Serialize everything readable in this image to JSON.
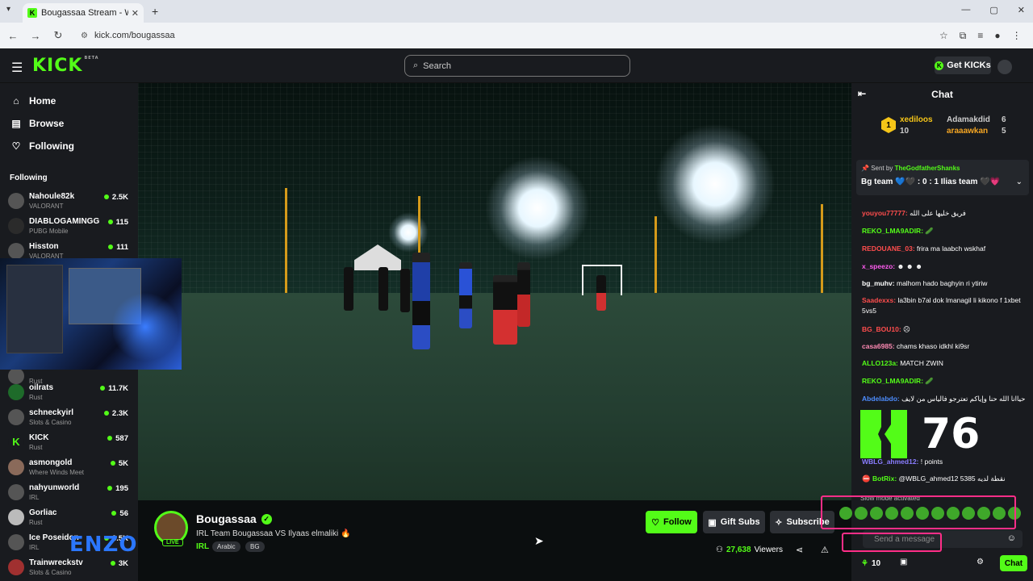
{
  "browser": {
    "tab_title": "Bougassaa Stream - Watch",
    "url": "kick.com/bougassaa"
  },
  "header": {
    "logo": "KICK",
    "logo_badge": "BETA",
    "search_placeholder": "Search",
    "get_kicks": "Get KICKs"
  },
  "sidebar": {
    "nav": [
      {
        "label": "Home",
        "icon": "home-icon"
      },
      {
        "label": "Browse",
        "icon": "browse-icon"
      },
      {
        "label": "Following",
        "icon": "heart-icon"
      }
    ],
    "following_title": "Following",
    "channels": [
      {
        "name": "Nahoule82k",
        "game": "VALORANT",
        "viewers": "2.5K"
      },
      {
        "name": "DIABLOGAMINGG",
        "game": "PUBG Mobile",
        "viewers": "115"
      },
      {
        "name": "Hisston",
        "game": "VALORANT",
        "viewers": "111"
      },
      {
        "name": "",
        "game": "Rust",
        "viewers": ""
      },
      {
        "name": "oilrats",
        "game": "Rust",
        "viewers": "11.7K"
      },
      {
        "name": "schneckyirl",
        "game": "Slots & Casino",
        "viewers": "2.3K"
      },
      {
        "name": "KICK",
        "game": "Rust",
        "viewers": "587"
      },
      {
        "name": "asmongold",
        "game": "Where Winds Meet",
        "viewers": "5K"
      },
      {
        "name": "nahyunworld",
        "game": "IRL",
        "viewers": "195"
      },
      {
        "name": "Gorliac",
        "game": "Rust",
        "viewers": "56"
      },
      {
        "name": "Ice Poseidon",
        "game": "IRL",
        "viewers": "3.5K"
      },
      {
        "name": "Trainwreckstv",
        "game": "Slots & Casino",
        "viewers": "3K"
      }
    ],
    "overlay_text": "ENZO"
  },
  "stream": {
    "streamer": "Bougassaa",
    "live_label": "LIVE",
    "title": "IRL Team Bougassaa VS Ilyaas elmaliki 🔥",
    "category": "IRL",
    "tags": [
      "Arabic",
      "BG"
    ],
    "follow_label": "Follow",
    "gift_label": "Gift Subs",
    "subscribe_label": "Subscribe",
    "viewers": "27,638",
    "viewers_label": "Viewers"
  },
  "chat": {
    "title": "Chat",
    "leaderboard": [
      {
        "rank": "1",
        "name": "xediloos",
        "count": "10"
      },
      {
        "name": "Adamakdid",
        "count": "6"
      },
      {
        "name": "araaawkan",
        "count": "5"
      }
    ],
    "pinned_by_prefix": "Sent by",
    "pinned_by": "TheGodfatherShanks",
    "pinned_message": "Bg team 💙🖤 : 0 : 1 Ilias team 🖤💗",
    "messages": [
      {
        "user": "youyou77777:",
        "text": "فريق خليها على الله",
        "color": "#ff4d4d"
      },
      {
        "user": "REKO_LMA9ADIR:",
        "text": "",
        "color": "#53fc18"
      },
      {
        "user": "REDOUANE_03:",
        "text": "frira ma laabch wskhaf",
        "color": "#ff4d4d"
      },
      {
        "user": "x_speezo:",
        "text": "",
        "color": "#ff5cf0"
      },
      {
        "user": "bg_muhv:",
        "text": "malhom hado baghyin ri ytiriw",
        "color": "#ffffff"
      },
      {
        "user": "Saadexxs:",
        "text": "la3bin b7al dok lmanagil li kikono f 1xbet 5vs5",
        "color": "#ff4d4d"
      },
      {
        "user": "BG_BOU10:",
        "text": "",
        "color": "#ff4d4d"
      },
      {
        "user": "casa6985:",
        "text": "chams khaso idkhl ki9sr",
        "color": "#ff8ab4"
      },
      {
        "user": "ALLO123a:",
        "text": "MATCH ZWIN",
        "color": "#53fc18"
      },
      {
        "user": "REKO_LMA9ADIR:",
        "text": "",
        "color": "#53fc18"
      },
      {
        "user": "Abdelabdo:",
        "text": "حياانا الله حنا وإياكم تعترجو فالياس من لايف",
        "color": "#4d8dff"
      },
      {
        "user": "WBLG_ahmed12:",
        "text": "! points",
        "color": "#8a7dff"
      },
      {
        "user": "BotRix:",
        "text": "@WBLG_ahmed12 5385 نقطة لديه",
        "color": "#53fc18"
      }
    ],
    "big_counter": "76",
    "slow_mode": "Slow mode activated",
    "send_placeholder": "Send a message",
    "points": "10",
    "chat_button": "Chat"
  },
  "colors": {
    "accent": "#53fc18",
    "background": "#0b0e0f",
    "panel": "#191b1f",
    "overlay_pink": "#ff2e88"
  }
}
